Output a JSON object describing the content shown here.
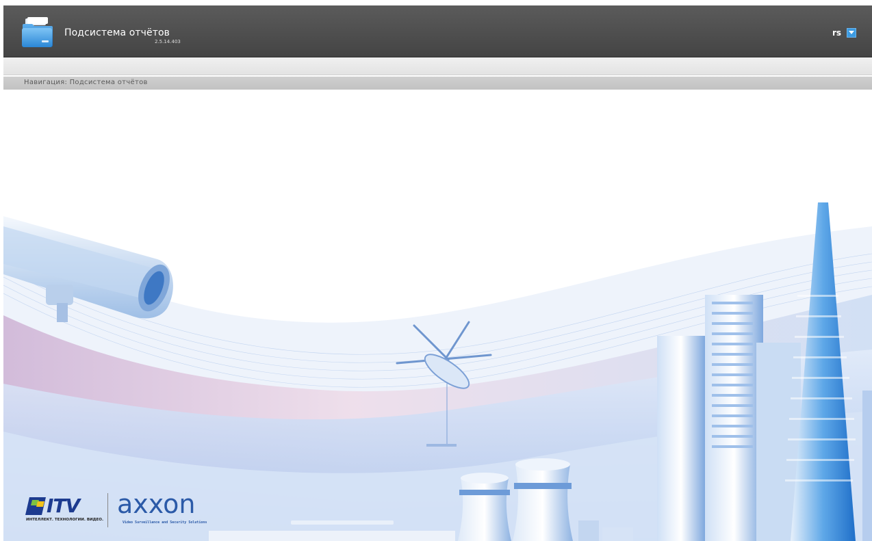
{
  "header": {
    "title": "Подсистема отчётов",
    "version": "2.5.14.403",
    "user": {
      "name": "rs",
      "dropdown_icon": "chevron-down-icon"
    },
    "app_icon": "folder-icon"
  },
  "breadcrumb": {
    "text": "Навигация: Подсистема отчётов"
  },
  "splash": {
    "logos": {
      "itv": {
        "name": "ITV",
        "tagline": "ИНТЕЛЛЕКТ. ТЕХНОЛОГИИ. ВИДЕО."
      },
      "axxon": {
        "name": "axxon",
        "tagline": "Video Surveillance and Security Solutions"
      }
    }
  },
  "colors": {
    "header_bg": "#4e4e4e",
    "accent_blue": "#3c9ae0",
    "breadcrumb_bg": "#c8c8c8"
  }
}
